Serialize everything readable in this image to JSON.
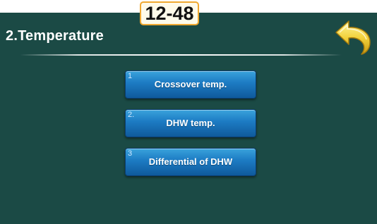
{
  "screen_code": "12-48",
  "header": {
    "title": "2.Temperature",
    "back_icon": "back-arrow-icon"
  },
  "menu": {
    "items": [
      {
        "number": "1",
        "label": "Crossover temp."
      },
      {
        "number": "2.",
        "label": "DHW temp."
      },
      {
        "number": "3",
        "label": "Differential of DHW"
      }
    ]
  },
  "colors": {
    "background": "#1b4a45",
    "button": "#1d7cc4",
    "badge_border": "#f0a830",
    "back_arrow": "#f2d23c"
  }
}
